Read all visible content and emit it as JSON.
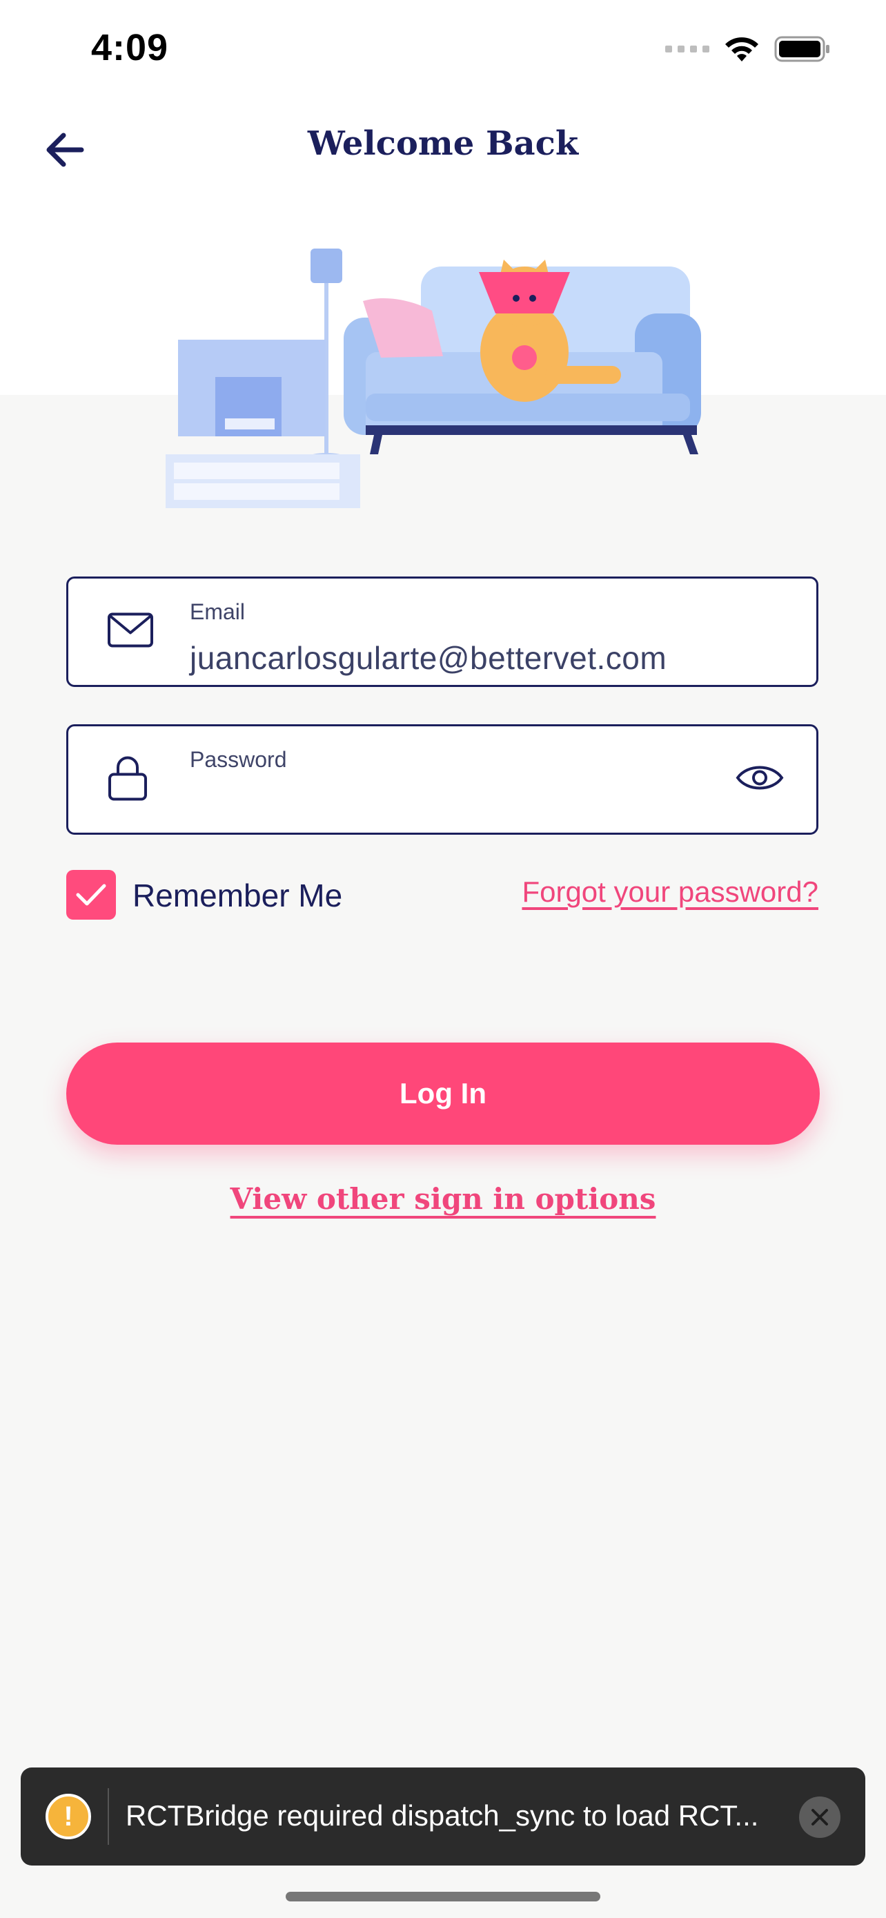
{
  "status_bar": {
    "time": "4:09"
  },
  "header": {
    "title": "Welcome Back",
    "back_icon": "arrow-left-icon"
  },
  "form": {
    "email": {
      "label": "Email",
      "value": "juancarlosgularte@bettervet.com",
      "icon": "mail-icon"
    },
    "password": {
      "label": "Password",
      "value": "",
      "icon": "lock-icon",
      "toggle_icon": "eye-icon"
    },
    "remember_me": {
      "label": "Remember Me",
      "checked": true
    },
    "forgot_password": "Forgot your password?",
    "login_button": "Log In",
    "other_options": "View other sign in options"
  },
  "toast": {
    "message": "RCTBridge required dispatch_sync to load RCT...",
    "icon": "warning-icon",
    "close_icon": "close-icon"
  },
  "colors": {
    "navy": "#1b1f5c",
    "accent": "#ff4779",
    "link": "#f0467c",
    "field_border": "#1b1f5c"
  }
}
